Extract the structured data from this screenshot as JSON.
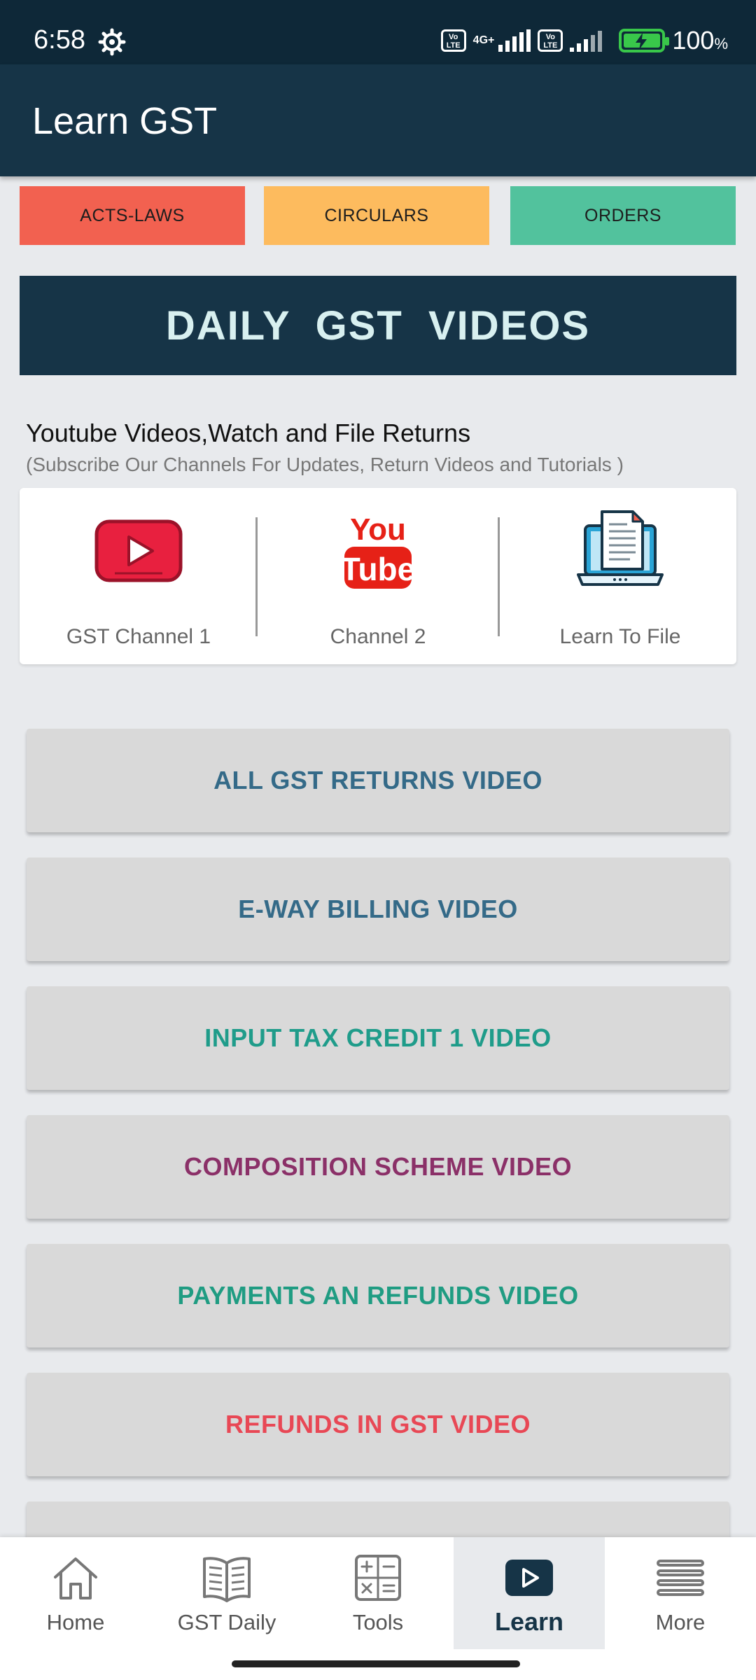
{
  "status_bar": {
    "time": "6:58",
    "network_label": "4G+",
    "battery": "100",
    "battery_unit": "%",
    "volte_label": "Vo LTE"
  },
  "app_bar": {
    "title": "Learn GST"
  },
  "tabs": [
    {
      "label": "ACTS-LAWS",
      "color": "#f26150"
    },
    {
      "label": "CIRCULARS",
      "color": "#fdbb5e"
    },
    {
      "label": "ORDERS",
      "color": "#52c29d"
    }
  ],
  "banner": {
    "title": "DAILY GST VIDEOS"
  },
  "youtube_section": {
    "heading": "Youtube Videos,Watch and File Returns",
    "subheading": "(Subscribe Our Channels For Updates, Return Videos and Tutorials )",
    "channels": [
      {
        "label": "GST Channel 1",
        "icon": "youtube-play-icon"
      },
      {
        "label": "Channel 2",
        "icon": "youtube-logo-icon",
        "logo_top": "You",
        "logo_bottom": "Tube"
      },
      {
        "label": "Learn To File",
        "icon": "laptop-document-icon"
      }
    ]
  },
  "video_buttons": [
    {
      "label": "ALL GST RETURNS VIDEO",
      "color": "#346a88"
    },
    {
      "label": "E-WAY BILLING VIDEO",
      "color": "#346a88"
    },
    {
      "label": "INPUT TAX CREDIT 1 VIDEO",
      "color": "#1f9c8a"
    },
    {
      "label": "COMPOSITION SCHEME VIDEO",
      "color": "#8b3068"
    },
    {
      "label": "PAYMENTS AN REFUNDS VIDEO",
      "color": "#1f9c82"
    },
    {
      "label": "REFUNDS IN GST VIDEO",
      "color": "#e84855"
    }
  ],
  "bottom_nav": [
    {
      "label": "Home",
      "icon": "home-icon"
    },
    {
      "label": "GST Daily",
      "icon": "book-icon"
    },
    {
      "label": "Tools",
      "icon": "calculator-icon"
    },
    {
      "label": "Learn",
      "icon": "play-icon",
      "active": true
    },
    {
      "label": "More",
      "icon": "menu-icon"
    }
  ]
}
